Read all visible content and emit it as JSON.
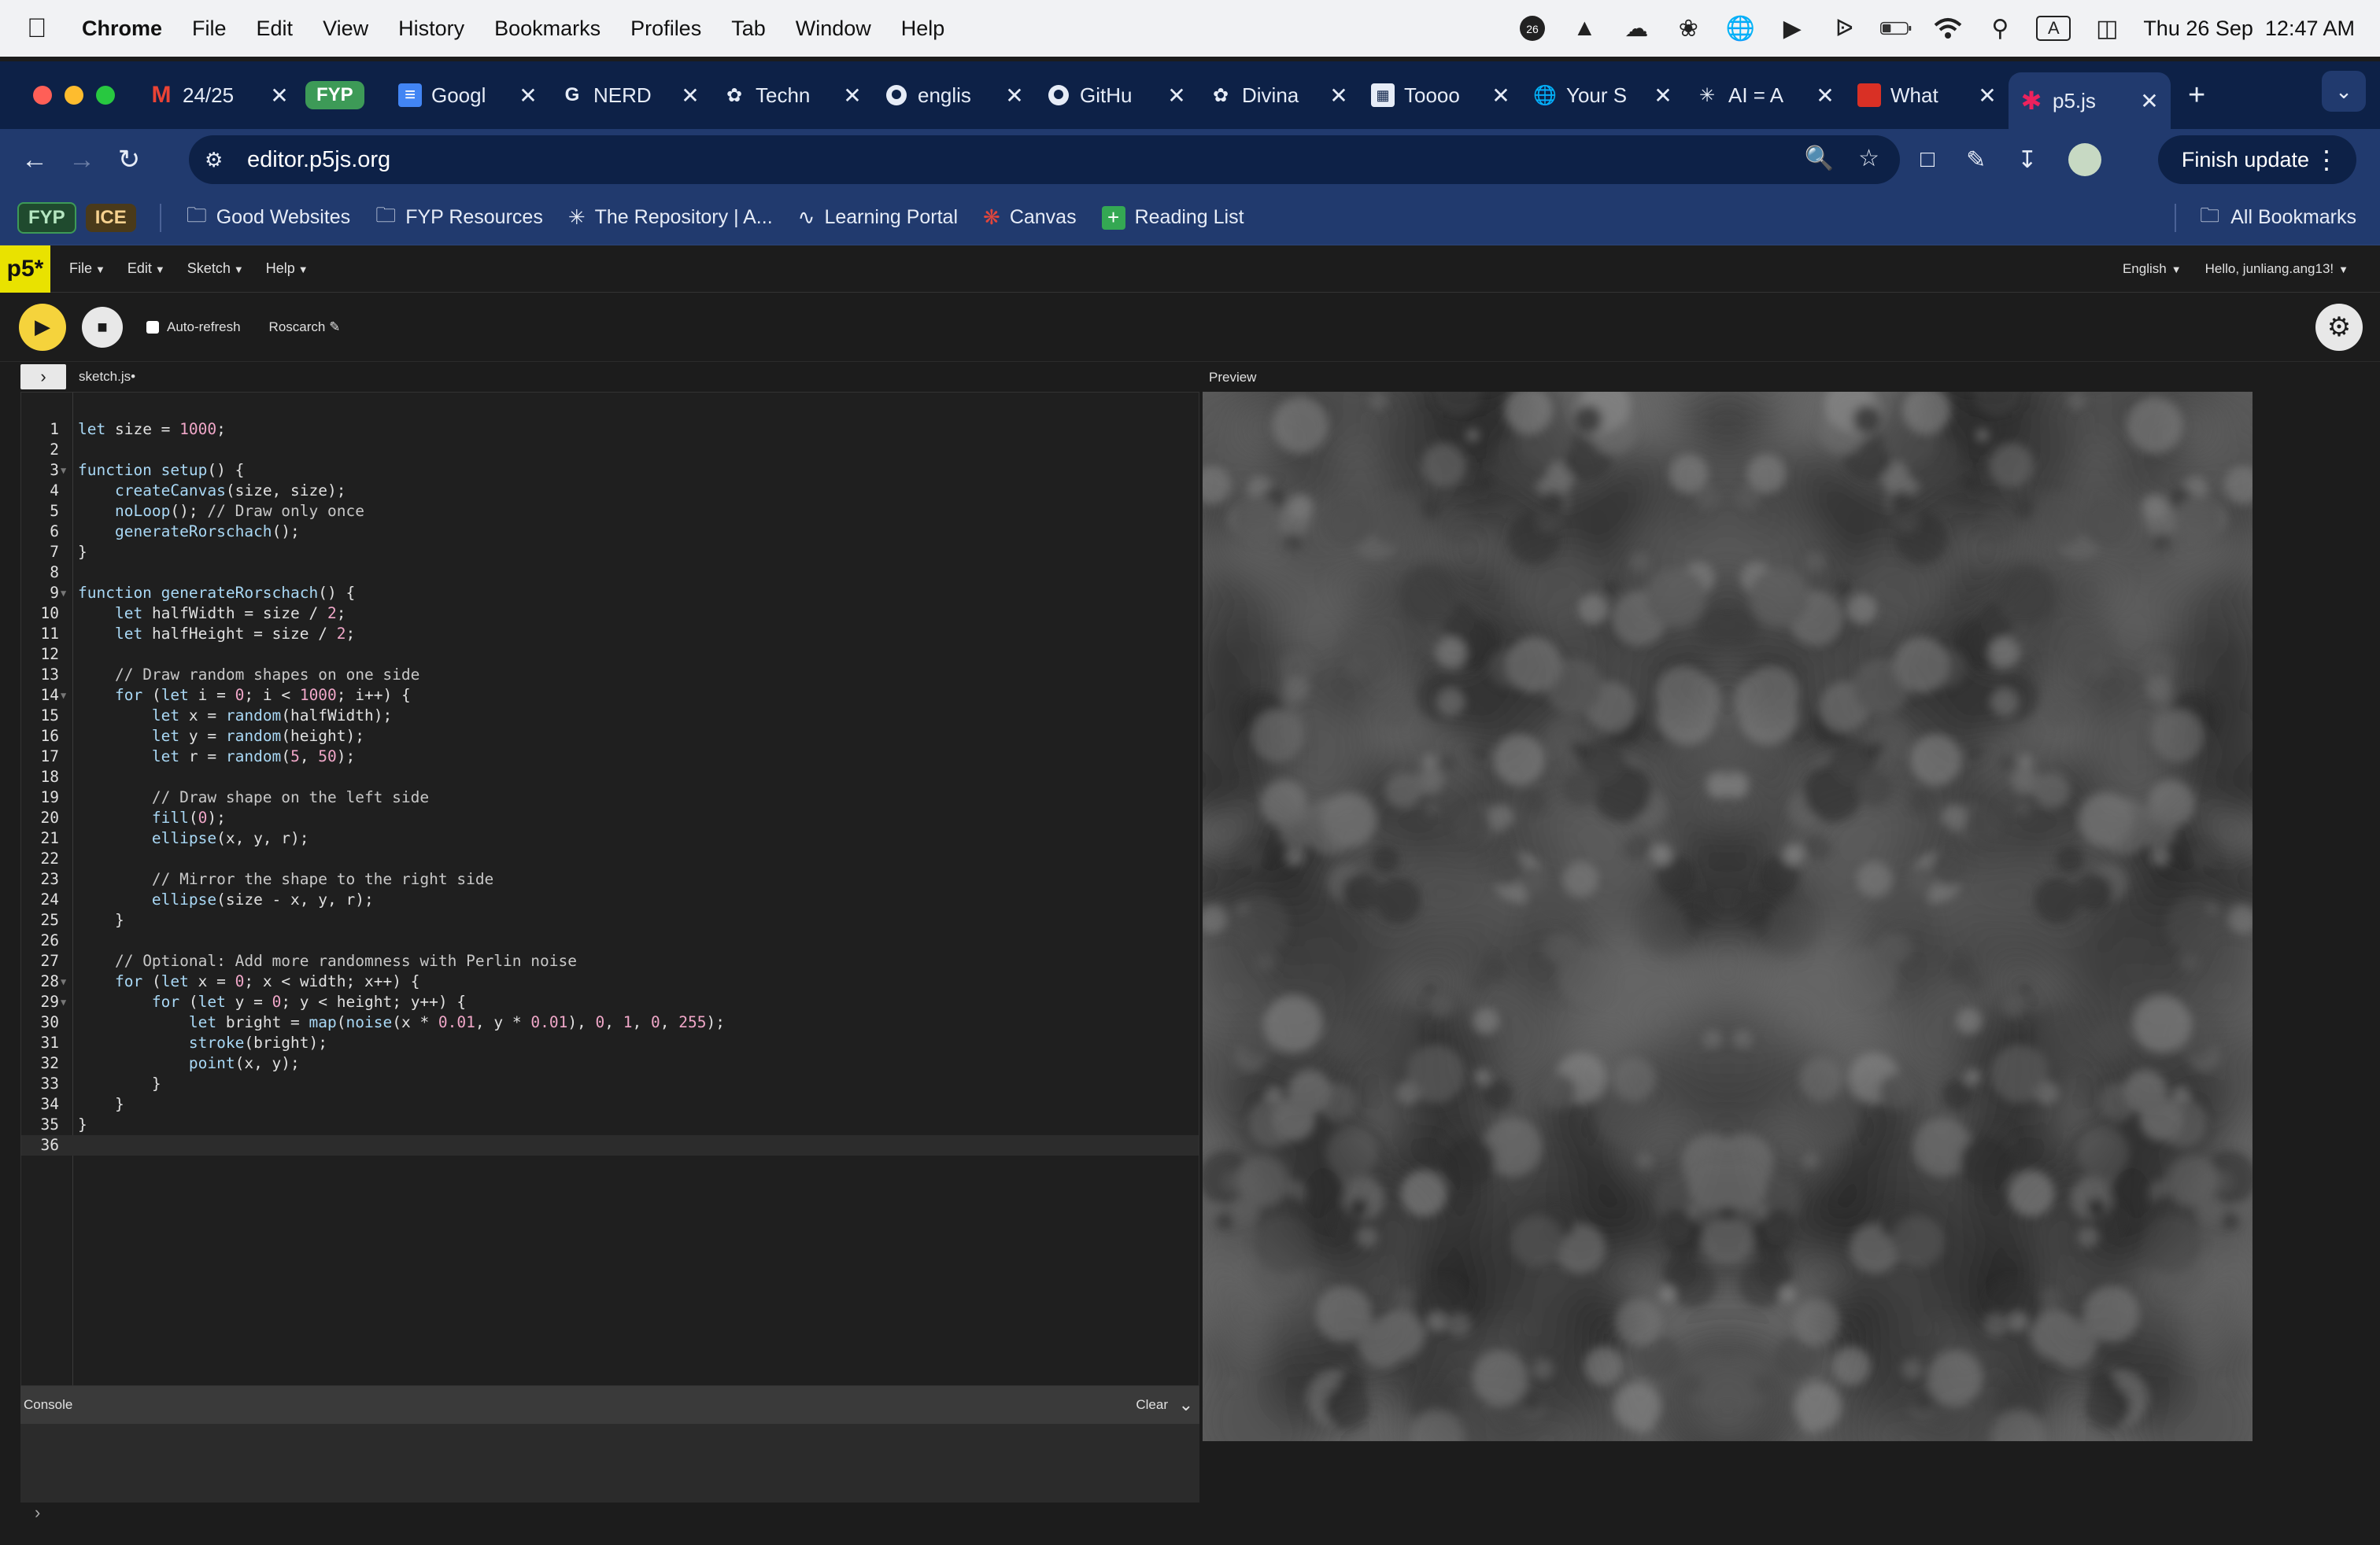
{
  "menubar": {
    "app": "Chrome",
    "items": [
      "File",
      "Edit",
      "View",
      "History",
      "Bookmarks",
      "Profiles",
      "Tab",
      "Window",
      "Help"
    ],
    "badge": "26",
    "input_mode": "A",
    "datetime": "Thu 26 Sep  12:47 AM"
  },
  "tabs": [
    {
      "label": "24/25",
      "icon": "gmail-icon"
    },
    {
      "label": "FYP",
      "group": true
    },
    {
      "label": "Googl",
      "icon": "google-docs-icon"
    },
    {
      "label": "NERD",
      "icon": "grammarly-icon"
    },
    {
      "label": "Techn",
      "icon": "openai-icon"
    },
    {
      "label": "englis",
      "icon": "github-icon"
    },
    {
      "label": "GitHu",
      "icon": "github-icon"
    },
    {
      "label": "Divina",
      "icon": "openai-icon"
    },
    {
      "label": "Toooo",
      "icon": "site-icon"
    },
    {
      "label": "Your S",
      "icon": "globe-icon"
    },
    {
      "label": "AI = A",
      "icon": "ai-icon"
    },
    {
      "label": "What",
      "icon": "red-icon"
    },
    {
      "label": "p5.js",
      "icon": "p5-icon",
      "active": true
    }
  ],
  "omnibox": {
    "url": "editor.p5js.org"
  },
  "toolbar": {
    "finish_update": "Finish update"
  },
  "bookmarks": {
    "groups": [
      {
        "label": "FYP"
      },
      {
        "label": "ICE"
      }
    ],
    "items": [
      {
        "label": "Good Websites",
        "icon": "folder-icon"
      },
      {
        "label": "FYP Resources",
        "icon": "folder-icon"
      },
      {
        "label": "The Repository | A...",
        "icon": "repository-icon"
      },
      {
        "label": "Learning Portal",
        "icon": "learning-portal-icon"
      },
      {
        "label": "Canvas",
        "icon": "canvas-icon"
      },
      {
        "label": "Reading List",
        "icon": "reading-list-icon"
      }
    ],
    "all": "All Bookmarks"
  },
  "p5": {
    "logo": "p5*",
    "menu": [
      "File",
      "Edit",
      "Sketch",
      "Help"
    ],
    "language": "English",
    "user": "Hello, junliang.ang13!",
    "auto_refresh": "Auto-refresh",
    "sketch_name": "Roscarch",
    "file_tab": "sketch.js",
    "preview_label": "Preview",
    "console_label": "Console",
    "clear_label": "Clear"
  },
  "code": [
    "let size = 1000;",
    "",
    "function setup() {",
    "    createCanvas(size, size);",
    "    noLoop(); // Draw only once",
    "    generateRorschach();",
    "}",
    "",
    "function generateRorschach() {",
    "    let halfWidth = size / 2;",
    "    let halfHeight = size / 2;",
    "",
    "    // Draw random shapes on one side",
    "    for (let i = 0; i < 1000; i++) {",
    "        let x = random(halfWidth);",
    "        let y = random(height);",
    "        let r = random(5, 50);",
    "",
    "        // Draw shape on the left side",
    "        fill(0);",
    "        ellipse(x, y, r);",
    "",
    "        // Mirror the shape to the right side",
    "        ellipse(size - x, y, r);",
    "    }",
    "",
    "    // Optional: Add more randomness with Perlin noise",
    "    for (let x = 0; x < width; x++) {",
    "        for (let y = 0; y < height; y++) {",
    "            let bright = map(noise(x * 0.01, y * 0.01), 0, 1, 0, 255);",
    "            stroke(bright);",
    "            point(x, y);",
    "        }",
    "    }",
    "}",
    ""
  ],
  "folds": [
    3,
    9,
    14,
    28,
    29
  ],
  "current_line": 36,
  "colors": {
    "tab_strip": "#0d2147",
    "toolbar": "#213a6e",
    "fyp_group": "#3d9a57",
    "ice_group": "#f2a83b",
    "p5_pink": "#ed225d",
    "play": "#f5d33c",
    "editor_bg": "#1f1f1f",
    "keyword": "#a9d8f5",
    "number": "#f0a7c8",
    "comment": "#c8c8c8"
  }
}
